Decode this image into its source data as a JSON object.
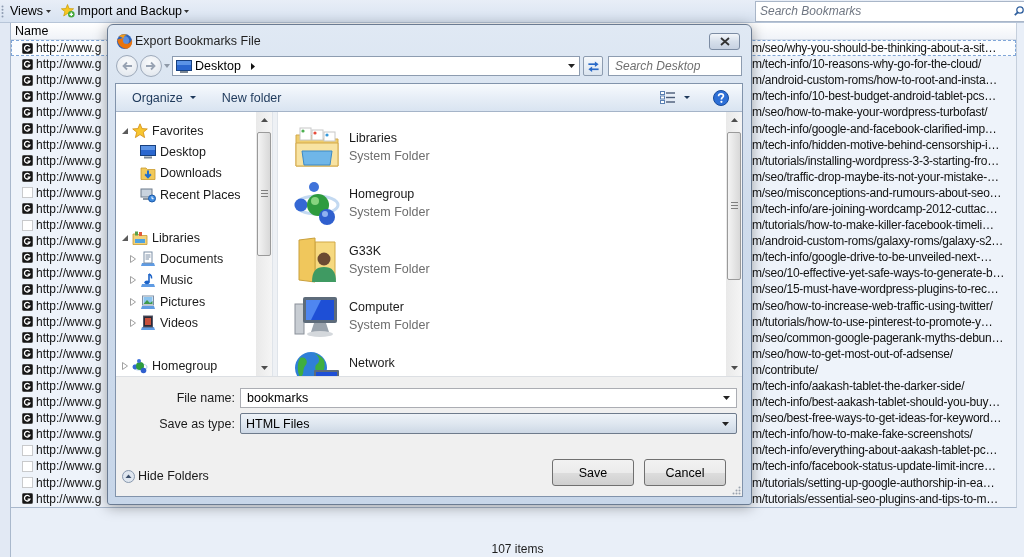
{
  "toolbar": {
    "views_menu": "Views",
    "import_menu": "Import and Backup",
    "search": {
      "placeholder": "Search Bookmarks"
    }
  },
  "list": {
    "column_header": "Name",
    "rows": [
      {
        "kind": "favicon",
        "selected": true,
        "url_start": "http://www.g",
        "url_end": "m/seo/why-you-should-be-thinking-about-a-sit…"
      },
      {
        "kind": "favicon",
        "selected": false,
        "url_start": "http://www.g",
        "url_end": "m/tech-info/10-reasons-why-go-for-the-cloud/"
      },
      {
        "kind": "favicon",
        "selected": false,
        "url_start": "http://www.g",
        "url_end": "m/android-custom-roms/how-to-root-and-insta…"
      },
      {
        "kind": "favicon",
        "selected": false,
        "url_start": "http://www.g",
        "url_end": "m/tech-info/10-best-budget-android-tablet-pcs…"
      },
      {
        "kind": "favicon",
        "selected": false,
        "url_start": "http://www.g",
        "url_end": "m/seo/how-to-make-your-wordpress-turbofast/"
      },
      {
        "kind": "favicon",
        "selected": false,
        "url_start": "http://www.g",
        "url_end": "m/tech-info/google-and-facebook-clarified-imp…"
      },
      {
        "kind": "favicon",
        "selected": false,
        "url_start": "http://www.g",
        "url_end": "m/tech-info/hidden-motive-behind-censorship-i…"
      },
      {
        "kind": "favicon",
        "selected": false,
        "url_start": "http://www.g",
        "url_end": "m/tutorials/installing-wordpress-3-3-starting-fro…"
      },
      {
        "kind": "favicon",
        "selected": false,
        "url_start": "http://www.g",
        "url_end": "m/seo/traffic-drop-maybe-its-not-your-mistake-…"
      },
      {
        "kind": "plain",
        "selected": false,
        "url_start": "http://www.g",
        "url_end": "m/seo/misconceptions-and-rumours-about-seo…"
      },
      {
        "kind": "favicon",
        "selected": false,
        "url_start": "http://www.g",
        "url_end": "m/tech-info/are-joining-wordcamp-2012-cuttac…"
      },
      {
        "kind": "plain",
        "selected": false,
        "url_start": "http://www.g",
        "url_end": "m/tutorials/how-to-make-killer-facebook-timeli…"
      },
      {
        "kind": "favicon",
        "selected": false,
        "url_start": "http://www.g",
        "url_end": "m/android-custom-roms/galaxy-roms/galaxy-s2…"
      },
      {
        "kind": "favicon",
        "selected": false,
        "url_start": "http://www.g",
        "url_end": "m/tech-info/google-drive-to-be-unveiled-next-…"
      },
      {
        "kind": "favicon",
        "selected": false,
        "url_start": "http://www.g",
        "url_end": "m/seo/10-effective-yet-safe-ways-to-generate-b…"
      },
      {
        "kind": "favicon",
        "selected": false,
        "url_start": "http://www.g",
        "url_end": "m/seo/15-must-have-wordpress-plugins-to-rec…"
      },
      {
        "kind": "favicon",
        "selected": false,
        "url_start": "http://www.g",
        "url_end": "m/seo/how-to-increase-web-traffic-using-twitter/"
      },
      {
        "kind": "favicon",
        "selected": false,
        "url_start": "http://www.g",
        "url_end": "m/tutorials/how-to-use-pinterest-to-promote-y…"
      },
      {
        "kind": "favicon",
        "selected": false,
        "url_start": "http://www.g",
        "url_end": "m/seo/common-google-pagerank-myths-debun…"
      },
      {
        "kind": "favicon",
        "selected": false,
        "url_start": "http://www.g",
        "url_end": "m/seo/how-to-get-most-out-of-adsense/"
      },
      {
        "kind": "favicon",
        "selected": false,
        "url_start": "http://www.g",
        "url_end": "m/contribute/"
      },
      {
        "kind": "favicon",
        "selected": false,
        "url_start": "http://www.g",
        "url_end": "m/tech-info/aakash-tablet-the-darker-side/"
      },
      {
        "kind": "favicon",
        "selected": false,
        "url_start": "http://www.g",
        "url_end": "m/tech-info/best-aakash-tablet-should-you-buy…"
      },
      {
        "kind": "favicon",
        "selected": false,
        "url_start": "http://www.g",
        "url_end": "m/seo/best-free-ways-to-get-ideas-for-keyword…"
      },
      {
        "kind": "favicon",
        "selected": false,
        "url_start": "http://www.g",
        "url_end": "m/tech-info/how-to-make-fake-screenshots/"
      },
      {
        "kind": "plain",
        "selected": false,
        "url_start": "http://www.g",
        "url_end": "m/tech-info/everything-about-aakash-tablet-pc…"
      },
      {
        "kind": "plain",
        "selected": false,
        "url_start": "http://www.g",
        "url_end": "m/tech-info/facebook-status-update-limit-incre…"
      },
      {
        "kind": "plain",
        "selected": false,
        "url_start": "http://www.g",
        "url_end": "m/tutorials/setting-up-google-authorship-in-ea…"
      },
      {
        "kind": "favicon",
        "selected": false,
        "url_start": "http://www.g",
        "url_end": "m/tutorials/essential-seo-plugins-and-tips-to-m…"
      }
    ]
  },
  "dialog": {
    "title": "Export Bookmarks File",
    "address": {
      "location": "Desktop"
    },
    "search": {
      "placeholder": "Search Desktop"
    },
    "commands": {
      "organize": "Organize",
      "new_folder": "New folder"
    },
    "nav_tree": [
      {
        "label": "Favorites",
        "kind": "favorites",
        "expanded": true,
        "children": [
          {
            "label": "Desktop",
            "kind": "desktop"
          },
          {
            "label": "Downloads",
            "kind": "downloads"
          },
          {
            "label": "Recent Places",
            "kind": "recent"
          }
        ]
      },
      {
        "label": "Libraries",
        "kind": "libraries",
        "expanded": true,
        "children": [
          {
            "label": "Documents",
            "kind": "documents",
            "expanded": false
          },
          {
            "label": "Music",
            "kind": "music",
            "expanded": false
          },
          {
            "label": "Pictures",
            "kind": "pictures",
            "expanded": false
          },
          {
            "label": "Videos",
            "kind": "videos",
            "expanded": false
          }
        ]
      },
      {
        "label": "Homegroup",
        "kind": "homegroup",
        "expanded": false
      }
    ],
    "files": [
      {
        "name": "Libraries",
        "type": "System Folder",
        "kind": "libraries"
      },
      {
        "name": "Homegroup",
        "type": "System Folder",
        "kind": "homegroup"
      },
      {
        "name": "G33K",
        "type": "System Folder",
        "kind": "user"
      },
      {
        "name": "Computer",
        "type": "System Folder",
        "kind": "computer"
      },
      {
        "name": "Network",
        "kind": "network"
      }
    ],
    "file_name": {
      "label": "File name:",
      "value": "bookmarks"
    },
    "save_type": {
      "label": "Save as type:",
      "value": "HTML Files"
    },
    "hide_folders": "Hide Folders",
    "buttons": [
      "Save",
      "Cancel"
    ]
  },
  "status_bar": {
    "text": "107 items"
  }
}
